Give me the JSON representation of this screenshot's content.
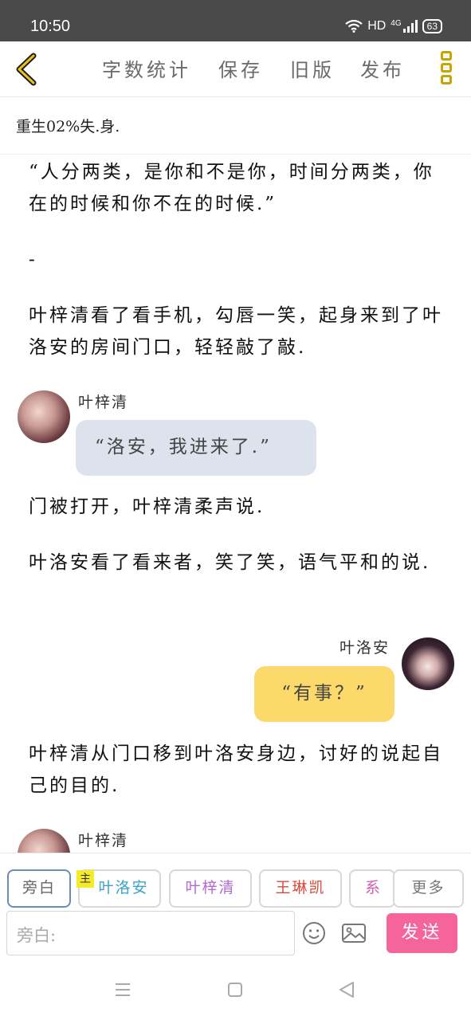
{
  "status": {
    "time": "10:50",
    "hd": "HD",
    "network": "4G",
    "battery": "63"
  },
  "toolbar": {
    "word_count": "字数统计",
    "save": "保存",
    "old_version": "旧版",
    "publish": "发布"
  },
  "chapter": {
    "title": "重生02%失.身."
  },
  "content": {
    "p1": "“人分两类，是你和不是你，时间分两类，你在的时候和你不在的时候.”",
    "p2": "-",
    "p3": "叶梓清看了看手机，勾唇一笑，起身来到了叶洛安的房间门口，轻轻敲了敲.",
    "msg1": {
      "speaker": "叶梓清",
      "text": "“洛安，我进来了.”"
    },
    "p4": "门被打开，叶梓清柔声说.",
    "p5": "叶洛安看了看来者，笑了笑，语气平和的说.",
    "msg2": {
      "speaker": "叶洛安",
      "text": "“有事？”"
    },
    "p6": "叶梓清从门口移到叶洛安身边，讨好的说起自己的目的.",
    "msg3": {
      "speaker": "叶梓清"
    }
  },
  "roles": {
    "narration": "旁白",
    "main_badge": "主",
    "role1": "叶洛安",
    "role2": "叶梓清",
    "role3": "王琳凯",
    "role4": "系统",
    "more": "更多"
  },
  "input": {
    "placeholder": "旁白:"
  },
  "send": "发送",
  "colors": {
    "accent_yellow": "#c9a400",
    "send_pink": "#f5659b",
    "bubble_left": "#dde3ec",
    "bubble_right": "#fbd96a",
    "role1_color": "#3aa3c8",
    "role2_color": "#b36ad0",
    "role3_color": "#d94a3a",
    "role4_color": "#d25ab0"
  }
}
